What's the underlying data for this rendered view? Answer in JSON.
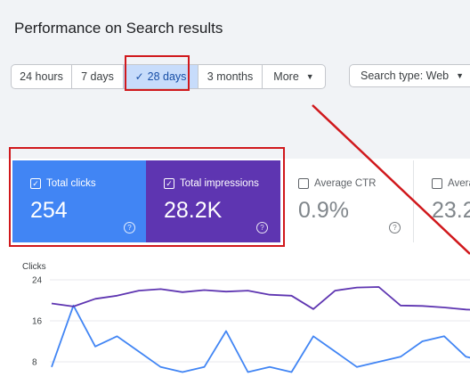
{
  "page": {
    "title": "Performance on Search results"
  },
  "date_range": {
    "options": [
      {
        "label": "24 hours"
      },
      {
        "label": "7 days"
      },
      {
        "label": "28 days",
        "selected": true
      },
      {
        "label": "3 months"
      },
      {
        "label": "More"
      }
    ]
  },
  "search_type": {
    "label": "Search type: Web"
  },
  "metrics": {
    "total_clicks": {
      "label": "Total clicks",
      "value": "254",
      "checked": true
    },
    "total_impressions": {
      "label": "Total impressions",
      "value": "28.2K",
      "checked": true
    },
    "average_ctr": {
      "label": "Average CTR",
      "value": "0.9%",
      "checked": false
    },
    "average_position": {
      "label": "Avera",
      "value": "23.2",
      "checked": false
    }
  },
  "colors": {
    "clicks": "#4185f4",
    "impressions": "#5e35b1",
    "highlight": "#d0181c"
  },
  "chart_data": {
    "type": "line",
    "ylabel": "Clicks",
    "yticks": [
      24,
      16,
      8
    ],
    "ylim": [
      6,
      25
    ],
    "x": [
      1,
      2,
      3,
      4,
      5,
      6,
      7,
      8,
      9,
      10,
      11,
      12,
      13,
      14,
      15,
      16,
      17,
      18,
      19,
      20,
      21,
      22
    ],
    "series": [
      {
        "name": "Total clicks",
        "values": [
          7,
          19,
          11,
          13,
          10,
          7,
          6,
          7,
          14,
          6,
          7,
          6,
          13,
          10,
          7,
          8,
          9,
          12,
          13,
          9,
          8,
          7
        ]
      },
      {
        "name": "Total impressions",
        "values": [
          19.4,
          18.8,
          20.3,
          20.9,
          21.9,
          22.2,
          21.6,
          22.0,
          21.7,
          21.9,
          21.1,
          20.9,
          18.3,
          21.9,
          22.5,
          22.6,
          19.0,
          18.9,
          18.6,
          18.2,
          18.0,
          17.8
        ]
      }
    ]
  }
}
